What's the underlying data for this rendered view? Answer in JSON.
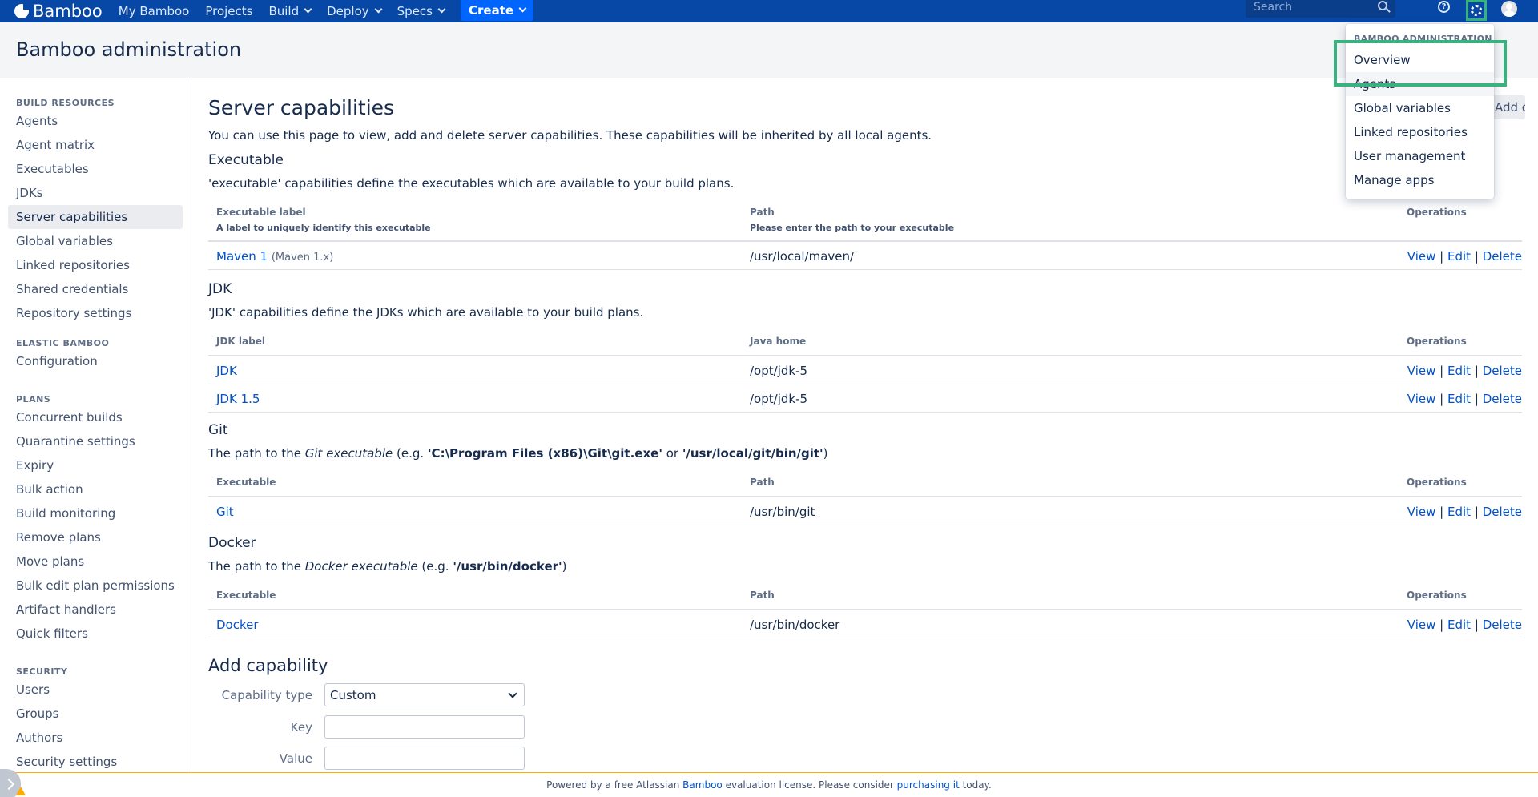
{
  "header": {
    "logo": "Bamboo",
    "nav": [
      "My Bamboo",
      "Projects",
      "Build",
      "Deploy",
      "Specs"
    ],
    "create_label": "Create",
    "search_placeholder": "Search",
    "help_glyph": "?"
  },
  "page_title": "Bamboo administration",
  "sidebar": {
    "groups": [
      {
        "title": "BUILD RESOURCES",
        "items": [
          "Agents",
          "Agent matrix",
          "Executables",
          "JDKs",
          "Server capabilities",
          "Global variables",
          "Linked repositories",
          "Shared credentials",
          "Repository settings"
        ]
      },
      {
        "title": "ELASTIC BAMBOO",
        "items": [
          "Configuration"
        ]
      },
      {
        "title": "PLANS",
        "items": [
          "Concurrent builds",
          "Quarantine settings",
          "Expiry",
          "Bulk action",
          "Build monitoring",
          "Remove plans",
          "Move plans",
          "Bulk edit plan permissions",
          "Artifact handlers",
          "Quick filters"
        ]
      },
      {
        "title": "SECURITY",
        "items": [
          "Users",
          "Groups",
          "Authors",
          "Security settings"
        ]
      }
    ],
    "active_item": "Server capabilities"
  },
  "main": {
    "title": "Server capabilities",
    "intro": "You can use this page to view, add and delete server capabilities. These capabilities will be inherited by all local agents.",
    "ops": {
      "view": "View",
      "edit": "Edit",
      "delete": "Delete",
      "sep": "|"
    },
    "executable": {
      "title": "Executable",
      "desc": "'executable' capabilities define the executables which are available to your build plans.",
      "col1": "Executable label",
      "col1_sub": "A label to uniquely identify this executable",
      "col2": "Path",
      "col2_sub": "Please enter the path to your executable",
      "col3": "Operations",
      "rows": [
        {
          "label": "Maven 1",
          "tag": "(Maven 1.x)",
          "path": "/usr/local/maven/"
        }
      ]
    },
    "jdk": {
      "title": "JDK",
      "desc": "'JDK' capabilities define the JDKs which are available to your build plans.",
      "col1": "JDK label",
      "col2": "Java home",
      "col3": "Operations",
      "rows": [
        {
          "label": "JDK",
          "path": "/opt/jdk-5"
        },
        {
          "label": "JDK 1.5",
          "path": "/opt/jdk-5"
        }
      ]
    },
    "git": {
      "title": "Git",
      "desc_a": "The path to the ",
      "desc_b": "Git executable",
      "desc_c": " (e.g. ",
      "desc_d": "'C:\\Program Files (x86)\\Git\\git.exe'",
      "desc_e": " or ",
      "desc_f": "'/usr/local/git/bin/git'",
      "desc_g": ")",
      "col1": "Executable",
      "col2": "Path",
      "col3": "Operations",
      "rows": [
        {
          "label": "Git",
          "path": "/usr/bin/git"
        }
      ]
    },
    "docker": {
      "title": "Docker",
      "desc_a": "The path to the ",
      "desc_b": "Docker executable",
      "desc_c": " (e.g. ",
      "desc_d": "'/usr/bin/docker'",
      "desc_e": ")",
      "col1": "Executable",
      "col2": "Path",
      "col3": "Operations",
      "rows": [
        {
          "label": "Docker",
          "path": "/usr/bin/docker"
        }
      ]
    },
    "add": {
      "title": "Add capability",
      "type_label": "Capability type",
      "type_value": "Custom",
      "key_label": "Key",
      "value_label": "Value"
    },
    "behind_button": "Add capabilities"
  },
  "dropdown": {
    "title": "BAMBOO ADMINISTRATION",
    "items": [
      "Overview",
      "Agents",
      "Global variables",
      "Linked repositories",
      "User management",
      "Manage apps"
    ]
  },
  "footer": {
    "a": "Powered by a free Atlassian ",
    "link1": "Bamboo",
    "b": " evaluation license. Please consider ",
    "link2": "purchasing it",
    "c": " today."
  },
  "colors": {
    "header": "#0747a6",
    "link": "#0052cc",
    "highlight": "#36b37e",
    "create": "#0065ff"
  }
}
